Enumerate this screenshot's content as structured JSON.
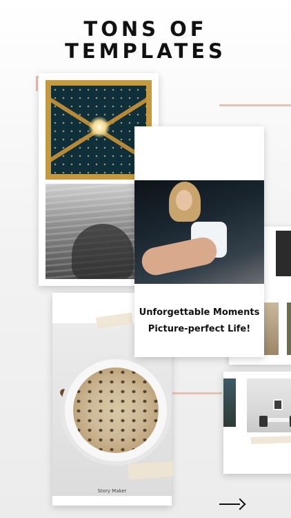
{
  "header": {
    "line1": "TONS OF",
    "line2": "TEMPLATES"
  },
  "template_card": {
    "quote_line1": "Unforgettable Moments",
    "quote_line2": "Picture-perfect Life!"
  },
  "food_card": {
    "footer_label": "Story Maker"
  },
  "colors": {
    "accent_line": "#e3c2b4",
    "background": "#f3f3f3",
    "text": "#111111"
  },
  "icons": {
    "next": "arrow-right-icon"
  }
}
